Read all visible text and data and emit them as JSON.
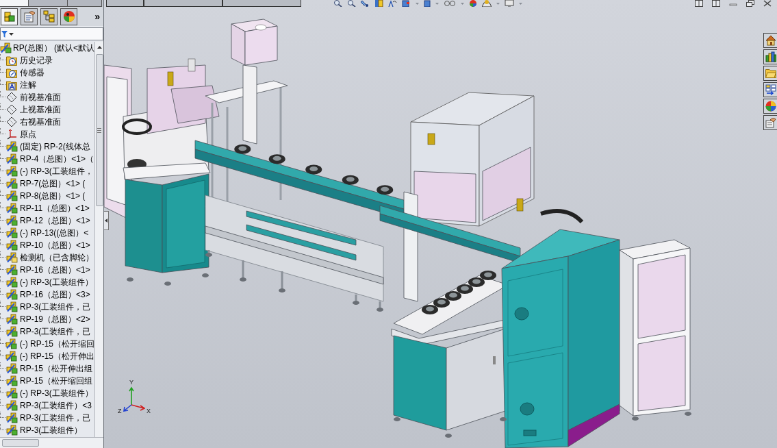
{
  "panel_tabs": [
    {
      "selected": true
    },
    {
      "selected": false
    },
    {
      "selected": false
    }
  ],
  "manager_tabs": [
    {
      "kind": "feature-tree",
      "selected": true
    },
    {
      "kind": "property",
      "selected": false
    },
    {
      "kind": "configuration",
      "selected": false
    },
    {
      "kind": "display",
      "selected": false
    }
  ],
  "more_button": "»",
  "feature_tree": {
    "label": "RP(总图） (默认<默认",
    "children": [
      {
        "kind": "history",
        "label": "历史记录"
      },
      {
        "kind": "sensor",
        "label": "传感器"
      },
      {
        "kind": "annotation",
        "label": "注解"
      },
      {
        "kind": "plane",
        "label": "前视基准面"
      },
      {
        "kind": "plane",
        "label": "上视基准面"
      },
      {
        "kind": "plane",
        "label": "右视基准面"
      },
      {
        "kind": "origin",
        "label": "原点"
      },
      {
        "kind": "assembly",
        "label": "(固定) RP-2(线体总"
      },
      {
        "kind": "assembly",
        "label": "RP-4（总图）<1>（"
      },
      {
        "kind": "assembly",
        "label": "(-) RP-3(工装组件，"
      },
      {
        "kind": "assembly",
        "label": "RP-7(总图）<1> ("
      },
      {
        "kind": "assembly",
        "label": "RP-8(总图）<1> ("
      },
      {
        "kind": "assembly",
        "label": "RP-11（总图）<1>"
      },
      {
        "kind": "assembly",
        "label": "RP-12（总图）<1>"
      },
      {
        "kind": "assembly",
        "label": "(-) RP-13((总图）<"
      },
      {
        "kind": "assembly",
        "label": "RP-10（总图）<1>"
      },
      {
        "kind": "assembly-plain",
        "label": "检测机（已含脚轮）"
      },
      {
        "kind": "assembly",
        "label": "RP-16（总图）<1>"
      },
      {
        "kind": "assembly",
        "label": "(-) RP-3(工装组件）"
      },
      {
        "kind": "assembly",
        "label": "RP-16（总图）<3>"
      },
      {
        "kind": "assembly",
        "label": "RP-3(工装组件，已"
      },
      {
        "kind": "assembly",
        "label": "RP-19（总图）<2>"
      },
      {
        "kind": "assembly",
        "label": "RP-3(工装组件，已"
      },
      {
        "kind": "assembly",
        "label": "(-) RP-15（松开缩回"
      },
      {
        "kind": "assembly",
        "label": "(-) RP-15（松开伸出"
      },
      {
        "kind": "assembly",
        "label": "RP-15（松开伸出组"
      },
      {
        "kind": "assembly",
        "label": "RP-15（松开缩回组"
      },
      {
        "kind": "assembly",
        "label": "(-) RP-3(工装组件）"
      },
      {
        "kind": "assembly",
        "label": "RP-3(工装组件）<3"
      },
      {
        "kind": "assembly",
        "label": "RP-3(工装组件，已"
      },
      {
        "kind": "assembly",
        "label": "RP-3(工装组件）"
      }
    ]
  },
  "command_tabs": [
    {
      "selected": false
    },
    {
      "selected": false
    },
    {
      "selected": false
    }
  ],
  "task_pane": [
    {
      "kind": "home"
    },
    {
      "kind": "library"
    },
    {
      "kind": "folder"
    },
    {
      "kind": "palette"
    },
    {
      "kind": "appearance"
    },
    {
      "kind": "properties"
    }
  ],
  "triad": {
    "y": "Y",
    "z": "Z",
    "x": "X"
  }
}
